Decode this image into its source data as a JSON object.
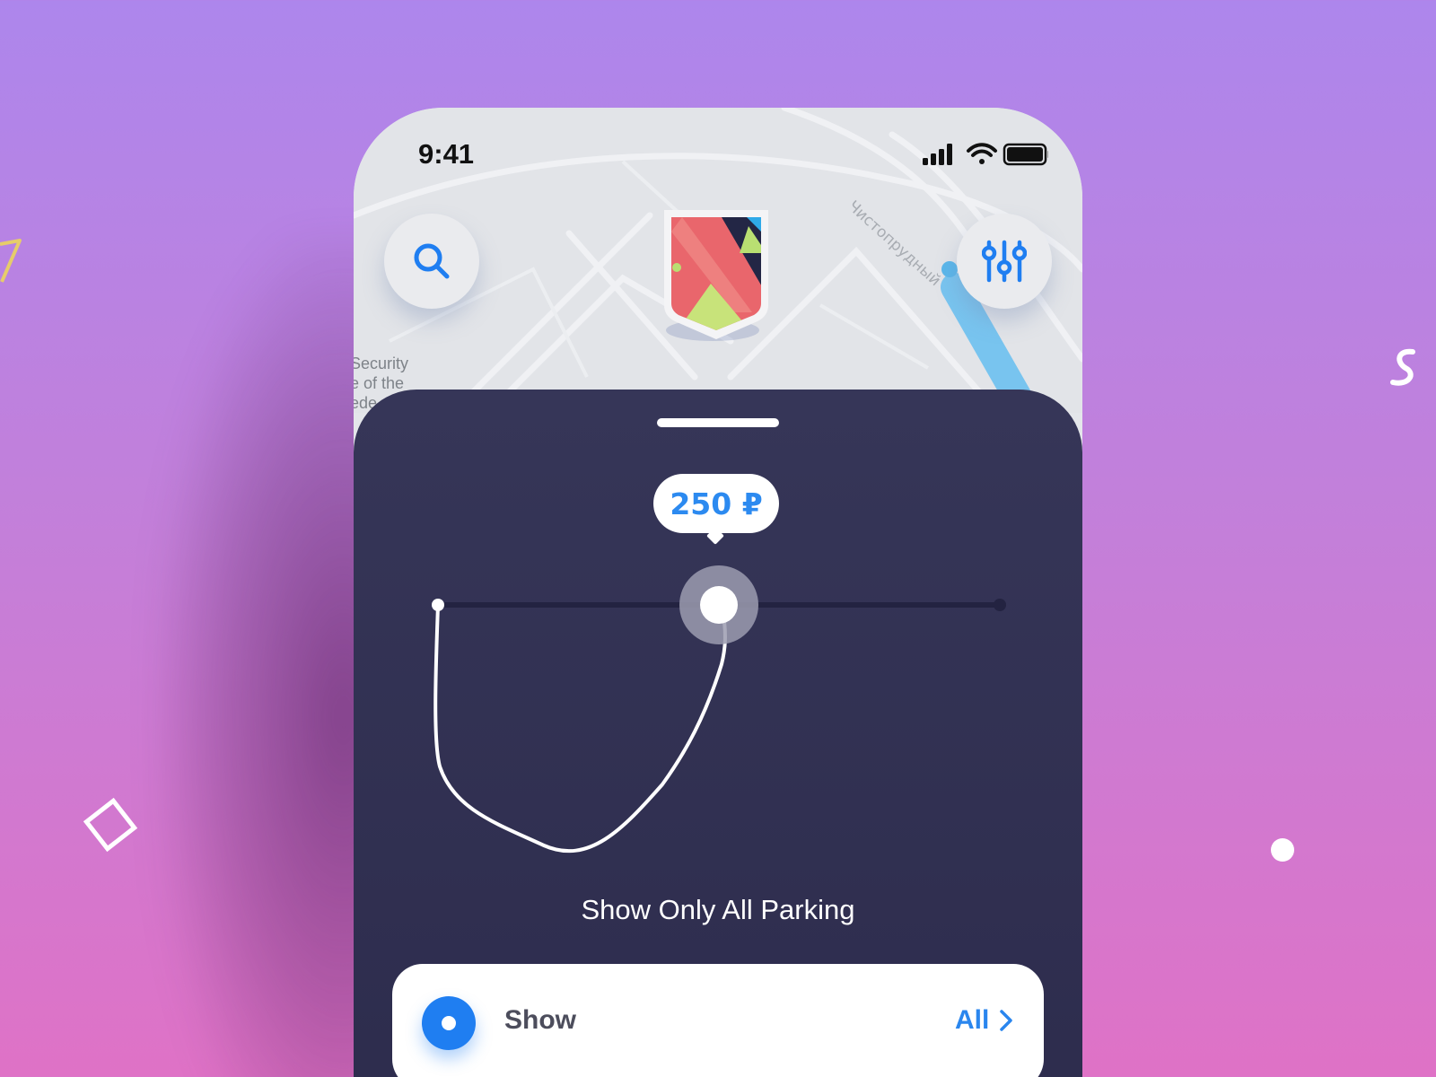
{
  "status_bar": {
    "time": "9:41"
  },
  "map": {
    "label_lines": [
      "Security",
      "e of the",
      "ede"
    ],
    "street_name": "Чистопрудный"
  },
  "icons": {
    "search": "search-icon",
    "filters": "sliders-icon",
    "logo": "app-logo",
    "signal": "cellular-signal-icon",
    "wifi": "wifi-icon",
    "battery": "battery-icon",
    "chevron": "chevron-right-icon"
  },
  "sheet": {
    "price": "250 ₽",
    "title": "Show Only All Parking",
    "option": {
      "label": "Show",
      "value": "All"
    }
  },
  "slider": {
    "position": 0.5
  },
  "colors": {
    "accent": "#1f7ef1",
    "price_text": "#2c8af0",
    "sheet_bg": "#2f2e50",
    "background_top": "#ad86ec",
    "background_bottom": "#df72c6"
  }
}
